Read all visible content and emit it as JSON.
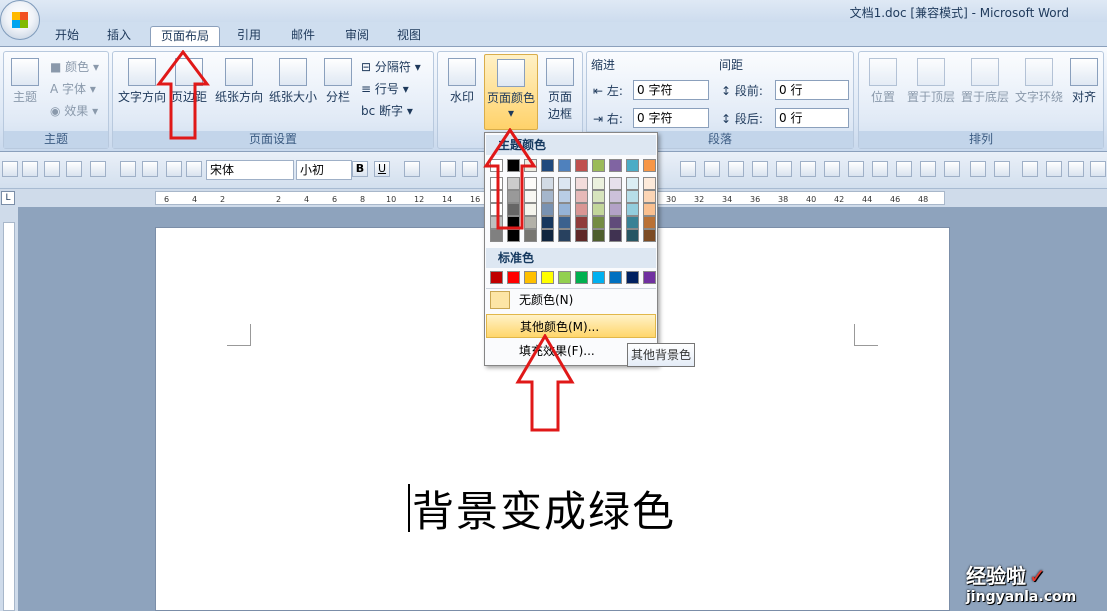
{
  "window": {
    "title": "文档1.doc [兼容模式] - Microsoft Word"
  },
  "tabs": [
    "开始",
    "插入",
    "页面布局",
    "引用",
    "邮件",
    "审阅",
    "视图"
  ],
  "active_tab": "页面布局",
  "ribbon": {
    "theme": {
      "main": "主题",
      "color": "颜色",
      "font": "字体",
      "effect": "效果",
      "group": "主题"
    },
    "page_setup": {
      "text_direction": "文字方向",
      "margins": "页边距",
      "orientation": "纸张方向",
      "size": "纸张大小",
      "columns": "分栏",
      "breaks": "分隔符",
      "line_numbers": "行号",
      "hyphenation": "断字",
      "group": "页面设置"
    },
    "background": {
      "watermark": "水印",
      "page_color": "页面颜色",
      "page_borders_1": "页面",
      "page_borders_2": "边框"
    },
    "paragraph": {
      "indent": "缩进",
      "spacing": "间距",
      "left": "左:",
      "right": "右:",
      "before": "段前:",
      "after": "段后:",
      "left_val": "0 字符",
      "right_val": "0 字符",
      "before_val": "0 行",
      "after_val": "0 行",
      "group": "段落"
    },
    "arrange": {
      "position": "位置",
      "front": "置于顶层",
      "back": "置于底层",
      "wrap": "文字环绕",
      "align": "对齐",
      "group": "排列"
    }
  },
  "toolbar": {
    "font": "宋体",
    "size": "小初",
    "bold": "B",
    "underline": "U"
  },
  "ruler": [
    "6",
    "4",
    "2",
    "2",
    "4",
    "6",
    "8",
    "10",
    "12",
    "14",
    "16",
    "30",
    "32",
    "34",
    "36",
    "38",
    "40",
    "42",
    "44",
    "46",
    "48"
  ],
  "page_color_menu": {
    "theme_header": "主题颜色",
    "standard_header": "标准色",
    "no_color": "无颜色(N)",
    "more_colors": "其他颜色(M)...",
    "fill_effects": "填充效果(F)...",
    "theme_colors": [
      "#ffffff",
      "#000000",
      "#eeece1",
      "#1f497d",
      "#4f81bd",
      "#c0504d",
      "#9bbb59",
      "#8064a2",
      "#4bacc6",
      "#f79646"
    ],
    "standard_colors": [
      "#c00000",
      "#ff0000",
      "#ffc000",
      "#ffff00",
      "#92d050",
      "#00b050",
      "#00b0f0",
      "#0070c0",
      "#002060",
      "#7030a0"
    ]
  },
  "tooltip": "其他背景色",
  "document": {
    "text": "背景变成绿色"
  },
  "watermark": {
    "line1": "经验啦",
    "check": "✓",
    "line2": "jingyanla.com"
  }
}
